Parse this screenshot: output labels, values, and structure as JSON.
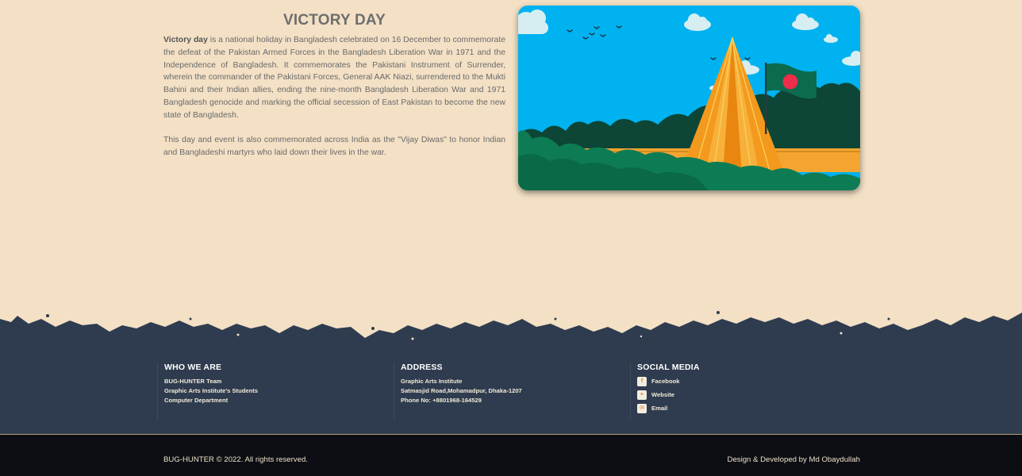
{
  "article": {
    "title": "VICTORY DAY",
    "para1_lead": "Victory day",
    "para1_body": " is a national holiday in Bangladesh celebrated on 16 December to commemorate the defeat of the Pakistan Armed Forces in the Bangladesh Liberation War in 1971 and the Independence of Bangladesh. It commemorates the Pakistani Instrument of Surrender, wherein the commander of the Pakistani Forces, General AAK Niazi, surrendered to the Mukti Bahini and their Indian allies, ending the nine-month Bangladesh Liberation War and 1971 Bangladesh genocide and marking the official secession of East Pakistan to become the new state of Bangladesh.",
    "para2": "This day and event is also commemorated across India as the \"Vijay Diwas\" to honor Indian and Bangladeshi martyrs who laid down their lives in the war."
  },
  "colors": {
    "page_background": "#f3e0c5",
    "sky": "#00b2f0",
    "footer": "#2f3c4f",
    "bottom_bar": "#0d0e13",
    "monument": "#f39a1e",
    "flag_green": "#0b6b4e",
    "flag_red": "#ee2d4b"
  },
  "footer": {
    "who": {
      "heading": "WHO WE ARE",
      "lines": [
        "BUG-HUNTER Team",
        "Graphic Arts Institute's Students",
        "Computer Department"
      ]
    },
    "address": {
      "heading": "ADDRESS",
      "lines": [
        "Graphic Arts Institute",
        "Satmasjid Road,Mohamadpur, Dhaka-1207",
        "Phone No: +8801968-164529"
      ]
    },
    "social": {
      "heading": "SOCIAL MEDIA",
      "items": [
        {
          "label": "Facebook",
          "icon": "facebook-icon"
        },
        {
          "label": "Website",
          "icon": "globe-icon"
        },
        {
          "label": "Email",
          "icon": "envelope-icon"
        }
      ]
    }
  },
  "bottom": {
    "copyright": "BUG-HUNTER © 2022. All rights reserved.",
    "credit": "Design & Developed by Md Obaydullah"
  }
}
